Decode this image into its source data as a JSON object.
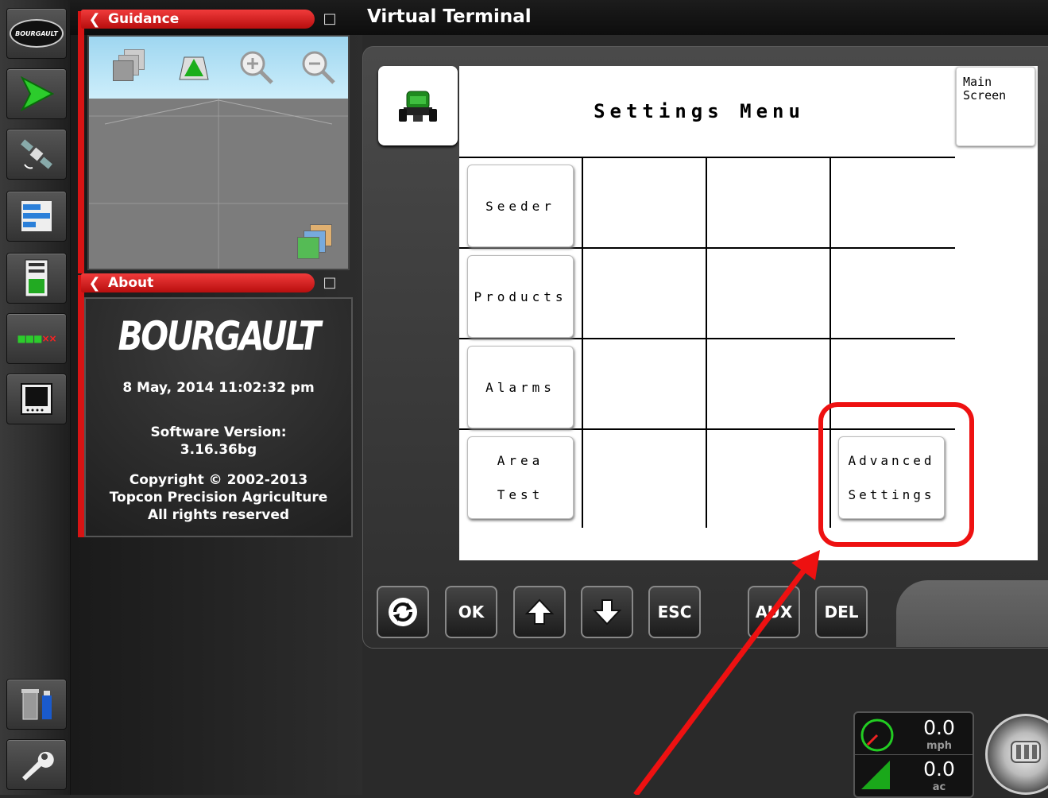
{
  "top_bar": {
    "title": "Virtual Terminal"
  },
  "rail": {
    "brand_badge": "BOURGAULT",
    "items": [
      {
        "icon": "bourgault-logo-icon"
      },
      {
        "icon": "guidance-arrow-icon"
      },
      {
        "icon": "satellite-icon"
      },
      {
        "icon": "layout-bars-icon"
      },
      {
        "icon": "calculator-icon"
      },
      {
        "icon": "section-status-icon",
        "text": "■■■××"
      },
      {
        "icon": "monitor-icon"
      },
      {
        "icon": "usb-data-icon"
      },
      {
        "icon": "wrench-icon"
      }
    ]
  },
  "guidance_panel": {
    "title": "Guidance"
  },
  "about_panel": {
    "title": "About",
    "logo": "BOURGAULT",
    "datetime": "8 May, 2014  11:02:32 pm",
    "version_label": "Software Version:",
    "version": "3.16.36bg",
    "copyright": "Copyright © 2002-2013",
    "company": "Topcon Precision Agriculture",
    "rights": "All rights reserved"
  },
  "vt": {
    "title": "Settings Menu",
    "main_screen": "Main\nScreen",
    "keys": {
      "seeder": "Seeder",
      "products": "Products",
      "alarms": "Alarms",
      "area_line1": "Area",
      "area_line2": "Test",
      "advanced_line1": "Advanced",
      "advanced_line2": "Settings"
    }
  },
  "softkeys": {
    "ok": "OK",
    "esc": "ESC",
    "aux": "AUX",
    "del": "DEL"
  },
  "status": {
    "speed": "0.0",
    "speed_unit": "mph",
    "area": "0.0",
    "area_unit": "ac"
  },
  "colors": {
    "accent_red": "#d71414",
    "annotation_red": "#e11111"
  }
}
